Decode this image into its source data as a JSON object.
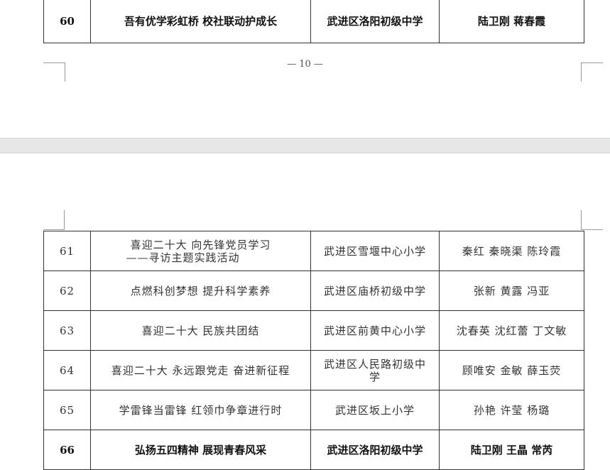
{
  "page1": {
    "rows": [
      {
        "num": "60",
        "title": "吾有优学彩虹桥 校社联动护成长",
        "school": "武进区洛阳初级中学",
        "teachers": "陆卫刚 蒋春霞"
      }
    ],
    "page_number": "— 10 —"
  },
  "page2": {
    "rows": [
      {
        "num": "61",
        "title_line1": "喜迎二十大 向先锋党员学习",
        "title_line2": "——寻访主题实践活动",
        "school": "武进区雪堰中心小学",
        "teachers": "秦红 秦晓渠 陈玲霞"
      },
      {
        "num": "62",
        "title": "点燃科创梦想 提升科学素养",
        "school": "武进区庙桥初级中学",
        "teachers": "张新 黄露 冯亚"
      },
      {
        "num": "63",
        "title": "喜迎二十大 民族共团结",
        "school": "武进区前黄中心小学",
        "teachers": "沈春英 沈红蕾 丁文敏"
      },
      {
        "num": "64",
        "title": "喜迎二十大 永远跟党走 奋进新征程",
        "school_line1": "武进区人民路初级中",
        "school_line2": "学",
        "teachers": "顾唯安 金敏 薛玉荧"
      },
      {
        "num": "65",
        "title": "学雷锋当雷锋 红领巾争章进行时",
        "school": "武进区坂上小学",
        "teachers": "孙艳 许莹 杨璐"
      },
      {
        "num": "66",
        "title": "弘扬五四精神 展现青春风采",
        "school": "武进区洛阳初级中学",
        "teachers": "陆卫刚 王晶 常芮"
      }
    ]
  }
}
